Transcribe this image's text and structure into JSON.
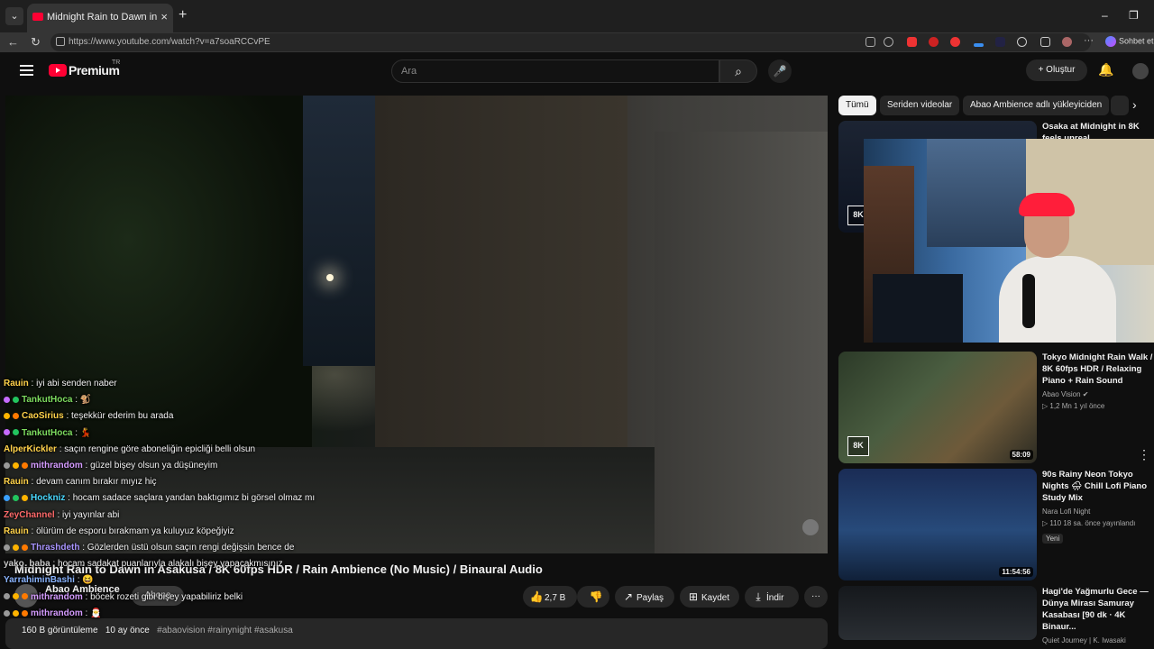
{
  "browser": {
    "tab_title": "Midnight Rain to Dawn in Asakusa",
    "tab_close": "×",
    "new_tab": "+",
    "tab_menu": "⌄",
    "url": "https://www.youtube.com/watch?v=a7soaRCCvPE",
    "copilot_label": "Sohbet et",
    "minimize": "–",
    "maximize": "❐"
  },
  "header": {
    "logo_text": "Premium",
    "logo_region": "TR",
    "search_placeholder": "Ara",
    "create_label": "+ Oluştur"
  },
  "chips": [
    {
      "label": "Tümü",
      "active": true
    },
    {
      "label": "Seriden videolar",
      "active": false
    },
    {
      "label": "Abao Ambience adlı yükleyiciden",
      "active": false
    }
  ],
  "chat": [
    {
      "user": "Rauin",
      "text": "iyi abi senden naber",
      "color": "#ffd24a",
      "badges": []
    },
    {
      "user": "TankutHoca",
      "text": "🐒",
      "color": "#7ddc5f",
      "badges": [
        "#c66bff",
        "#22c55e"
      ]
    },
    {
      "user": "CaoSirius",
      "text": "teşekkür ederim bu arada",
      "color": "#ffd24a",
      "badges": [
        "#ffb400",
        "#ff7a00"
      ]
    },
    {
      "user": "TankutHoca",
      "text": "💃",
      "color": "#7ddc5f",
      "badges": [
        "#c66bff",
        "#22c55e"
      ]
    },
    {
      "user": "AlperKickler",
      "text": "saçın rengine göre aboneliğin epicliği belli olsun",
      "color": "#ffd24a",
      "badges": []
    },
    {
      "user": "mithrandom",
      "text": "güzel bişey olsun ya düşüneyim",
      "color": "#d59cff",
      "badges": [
        "#999",
        "#ffb400",
        "#ff7a00"
      ]
    },
    {
      "user": "Rauin",
      "text": "devam canım bırakır mıyız hiç",
      "color": "#ffd24a",
      "badges": []
    },
    {
      "user": "Hockniz",
      "text": "hocam sadace saçlara yandan baktıgımız bi görsel olmaz mı",
      "color": "#4ad9ff",
      "badges": [
        "#3aa0ff",
        "#22c55e",
        "#ffb400"
      ]
    },
    {
      "user": "ZeyChannel",
      "text": "iyi yayınlar abi",
      "color": "#ff6a6a",
      "badges": []
    },
    {
      "user": "Rauin",
      "text": "ölürüm de esporu bırakmam ya kuluyuz köpeğiyiz",
      "color": "#ffd24a",
      "badges": []
    },
    {
      "user": "Thrashdeth",
      "text": "Gözlerden üstü olsun saçın rengi değişsin bence de",
      "color": "#a995ff",
      "badges": [
        "#999",
        "#ffb400",
        "#ff7a00"
      ]
    },
    {
      "user": "yako_baba",
      "text": "hocam sadakat puanlarıyla alakalı bişey yapacakmısınız",
      "color": "#c8c8c8",
      "badges": []
    },
    {
      "user": "YarrahiminBashi",
      "text": "😆",
      "color": "#8ab4ff",
      "badges": []
    },
    {
      "user": "mithrandom",
      "text": "böcek rozeti gibi bişey yapabiliriz belki",
      "color": "#d59cff",
      "badges": [
        "#999",
        "#ffb400",
        "#ff7a00"
      ]
    },
    {
      "user": "mithrandom",
      "text": "🎅",
      "color": "#d59cff",
      "badges": [
        "#999",
        "#ffb400",
        "#ff7a00"
      ]
    }
  ],
  "video": {
    "title": "Midnight Rain to Dawn in Asakusa / 8K 60fps HDR / Rain Ambience (No Music) / Binaural Audio",
    "channel": "Abao Ambience",
    "subscribe_label": "Abone",
    "like_count": "2,7 B",
    "share_label": "Paylaş",
    "save_label": "Kaydet",
    "download_label": "İndir",
    "views": "160 B görüntüleme",
    "age": "10 ay önce",
    "tags": "#abaovision #rainynight #asakusa"
  },
  "recommendations": [
    {
      "title": "Osaka at Midnight in 8K feels unreal",
      "channel": "",
      "meta": "",
      "duration": "",
      "badge_8k": true
    },
    {
      "title": "Tokyo Midnight Rain Walk / 8K 60fps HDR / Relaxing Piano + Rain Sound",
      "channel": "Abao Vision ✔",
      "meta": "▷ 1,2 Mn   1 yıl önce",
      "duration": "58:09",
      "badge_8k": true
    },
    {
      "title": "90s Rainy Neon Tokyo Nights 🌧 Chill Lofi Piano Study Mix",
      "channel": "Nara Lofi Night",
      "meta": "▷ 110   18 sa. önce yayınlandı",
      "new_badge": "Yeni",
      "duration": "11:54:56",
      "badge_8k": false
    },
    {
      "title": "Hagi'de Yağmurlu Gece — Dünya Mirası Samuray Kasabası [90 dk · 4K Binaur...",
      "channel": "Quiet Journey | K. Iwasaki",
      "meta": "",
      "duration": "",
      "badge_8k": false
    }
  ]
}
